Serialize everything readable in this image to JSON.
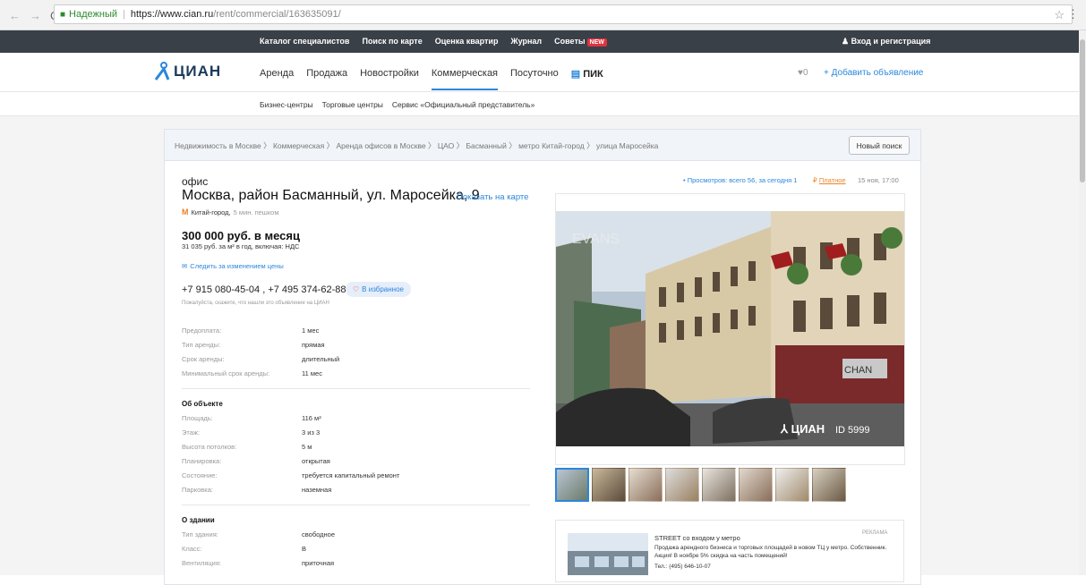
{
  "browser": {
    "secure_label": "Надежный",
    "url_host": "https://www.cian.ru",
    "url_path": "/rent/commercial/163635091/"
  },
  "topbar": {
    "links": [
      "Каталог специалистов",
      "Поиск по карте",
      "Оценка квартир",
      "Журнал",
      "Советы"
    ],
    "new_badge": "NEW",
    "login": "Вход и регистрация"
  },
  "logo_text": "ЦИАН",
  "mainnav": {
    "items": [
      "Аренда",
      "Продажа",
      "Новостройки",
      "Коммерческая",
      "Посуточно"
    ],
    "pik": "ПИК",
    "fav_count": "0",
    "add_ad": "+ Добавить объявление"
  },
  "subnav": [
    "Бизнес-центры",
    "Торговые центры",
    "Сервис «Официальный представитель»"
  ],
  "breadcrumbs": "Недвижимость в Москве  〉 Коммерческая  〉 Аренда офисов в Москве  〉 ЦАО  〉 Басманный  〉 метро Китай-город  〉 улица Маросейка",
  "new_search": "Новый поиск",
  "listing": {
    "type": "офис",
    "address": "Москва, район Басманный, ул. Маросейка, 9",
    "show_map": "Показать на карте",
    "metro": "Китай-город,",
    "metro_walk": "5 мин. пешком",
    "price": "300 000 руб. в месяц",
    "price_sub": "31 035 руб. за м² в год, включая: НДС",
    "track_price": "Следить за изменением цены",
    "phones": "+7 915 080-45-04 , +7 495 374-62-88",
    "favorite": "В избранное",
    "please_note": "Пожалуйста, скажите, что нашли это объявление на ЦИАН",
    "terms": [
      {
        "k": "Предоплата:",
        "v": "1 мес"
      },
      {
        "k": "Тип аренды:",
        "v": "прямая"
      },
      {
        "k": "Срок аренды:",
        "v": "длительный"
      },
      {
        "k": "Минимальный срок аренды:",
        "v": "11 мес"
      }
    ],
    "object_title": "Об объекте",
    "object": [
      {
        "k": "Площадь:",
        "v": "116 м²"
      },
      {
        "k": "Этаж:",
        "v": "3 из 3"
      },
      {
        "k": "Высота потолков:",
        "v": "5 м"
      },
      {
        "k": "Планировка:",
        "v": "открытая"
      },
      {
        "k": "Состояние:",
        "v": "требуется капитальный ремонт"
      },
      {
        "k": "Парковка:",
        "v": "наземная"
      }
    ],
    "building_title": "О здании",
    "building": [
      {
        "k": "Тип здания:",
        "v": "свободное"
      },
      {
        "k": "Класс:",
        "v": "B"
      },
      {
        "k": "Вентиляция:",
        "v": "приточная"
      }
    ]
  },
  "meta": {
    "stats": "• Просмотров: всего 56, за сегодня 1",
    "paid": "Платное",
    "date": "15 ноя, 17:00"
  },
  "photo": {
    "watermark": "ЦИАН",
    "id_label": "ID 5999",
    "sign_text": "EVANS",
    "shop_text": "CHAN"
  },
  "ad": {
    "title": "STREET со входом у метро",
    "label": "РЕКЛАМА",
    "text": "Продажа арендного бизнеса и торговых площадей в новом ТЦ у метро. Собственник. Акция! В ноябре 5% скидка на часть помещений!",
    "phone": "Тел.: (495) 646-10-07"
  },
  "colors": {
    "accent": "#2b87db",
    "dark_bar": "#3a4048",
    "orange": "#e8852a"
  }
}
